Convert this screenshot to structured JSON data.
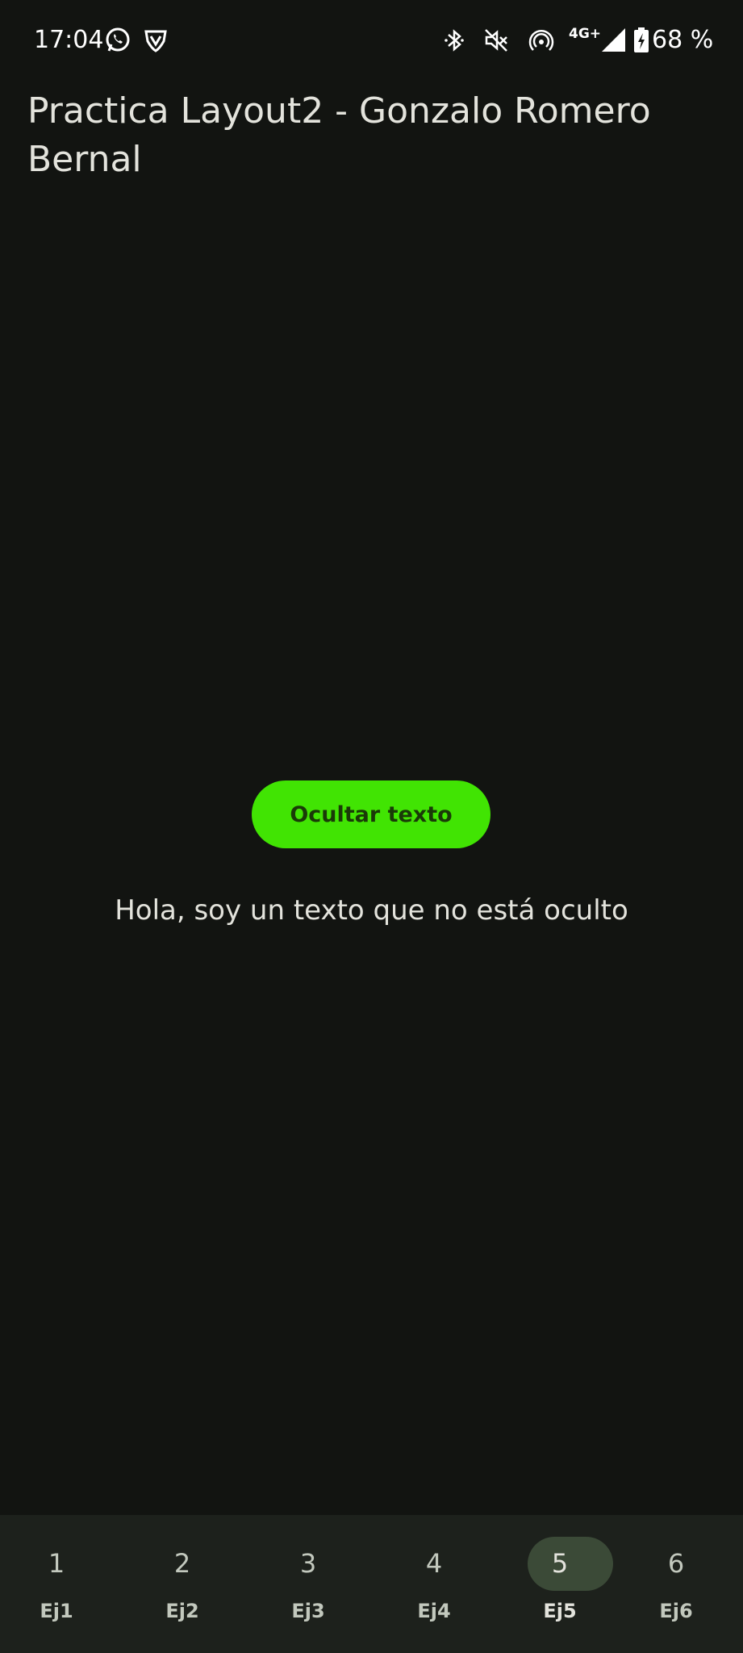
{
  "status_bar": {
    "time": "17:04",
    "network": "4G+",
    "battery": "68 %",
    "icons": [
      "whatsapp-icon",
      "vpn-shield-icon",
      "bluetooth-icon",
      "mute-icon",
      "hotspot-icon",
      "signal-icon",
      "battery-charging-icon"
    ]
  },
  "app": {
    "title": "Practica Layout2 - Gonzalo Romero Bernal"
  },
  "main": {
    "button_label": "Ocultar texto",
    "text": "Hola, soy un texto que no está oculto"
  },
  "bottom_nav": {
    "items": [
      {
        "number": "1",
        "label": "Ej1",
        "active": false
      },
      {
        "number": "2",
        "label": "Ej2",
        "active": false
      },
      {
        "number": "3",
        "label": "Ej3",
        "active": false
      },
      {
        "number": "4",
        "label": "Ej4",
        "active": false
      },
      {
        "number": "5",
        "label": "Ej5",
        "active": true
      },
      {
        "number": "6",
        "label": "Ej6",
        "active": false
      }
    ]
  },
  "colors": {
    "background": "#121411",
    "accent_button": "#41e403",
    "nav_background": "#1d211c",
    "nav_active_pill": "#3b4a37"
  }
}
